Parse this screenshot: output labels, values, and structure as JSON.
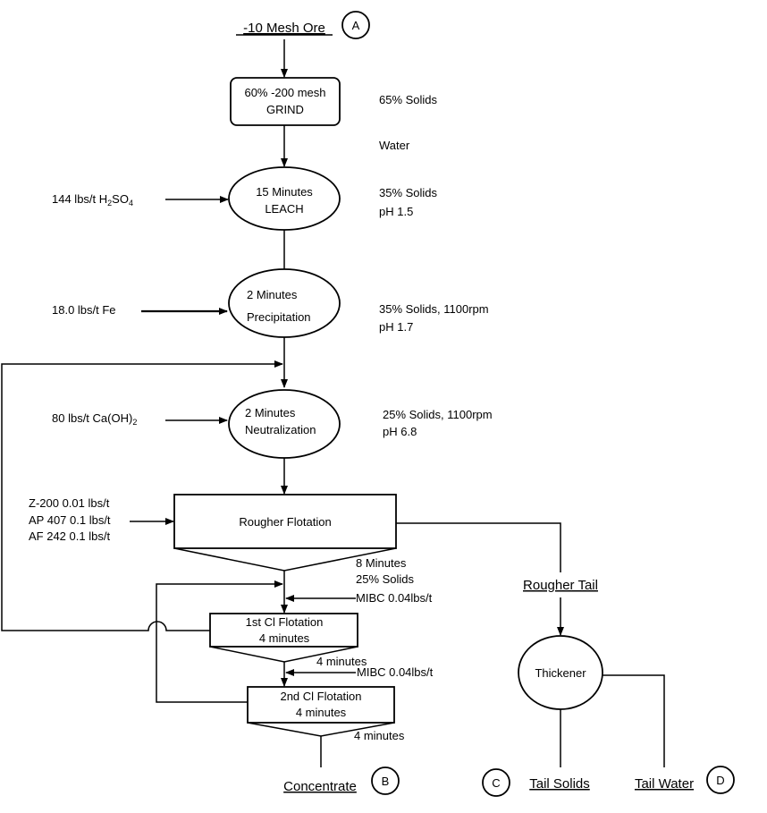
{
  "nodes": {
    "feed": "-10 Mesh Ore",
    "grind": [
      "60% -200 mesh",
      "GRIND"
    ],
    "leach": [
      "15 Minutes",
      "LEACH"
    ],
    "precipitation": [
      "2 Minutes",
      "Precipitation"
    ],
    "neutralization": [
      "2 Minutes",
      "Neutralization"
    ],
    "rougher": "Rougher Flotation",
    "cleaner1": [
      "1st Cl Flotation",
      "4 minutes"
    ],
    "cleaner2": [
      "2nd Cl Flotation",
      "4 minutes"
    ],
    "rougher_tail": "Rougher Tail",
    "thickener": "Thickener",
    "concentrate": "Concentrate",
    "tail_solids": "Tail Solids",
    "tail_water": "Tail Water"
  },
  "markers": {
    "a": "A",
    "b": "B",
    "c": "C",
    "d": "D"
  },
  "inputs": {
    "acid_prefix": "144 lbs/t H",
    "acid_sub1": "2",
    "acid_mid": "SO",
    "acid_sub2": "4",
    "iron": "18.0 lbs/t Fe",
    "lime_prefix": "80 lbs/t Ca(OH)",
    "lime_sub": "2",
    "reagents": [
      "Z-200 0.01 lbs/t",
      "AP 407 0.1 lbs/t",
      "AF 242 0.1 lbs/t"
    ],
    "mibc1": "MIBC 0.04lbs/t",
    "mibc2": "MIBC 0.04lbs/t"
  },
  "conditions": {
    "grind": "65% Solids",
    "water": "Water",
    "leach": [
      "35% Solids",
      "pH 1.5"
    ],
    "precipitation": [
      "35% Solids, 1100rpm",
      "pH 1.7"
    ],
    "neutralization": [
      "25% Solids, 1100rpm",
      "pH 6.8"
    ],
    "rougher": [
      "8 Minutes",
      "25% Solids"
    ],
    "cleaner1": "4 minutes",
    "cleaner2": "4 minutes"
  }
}
